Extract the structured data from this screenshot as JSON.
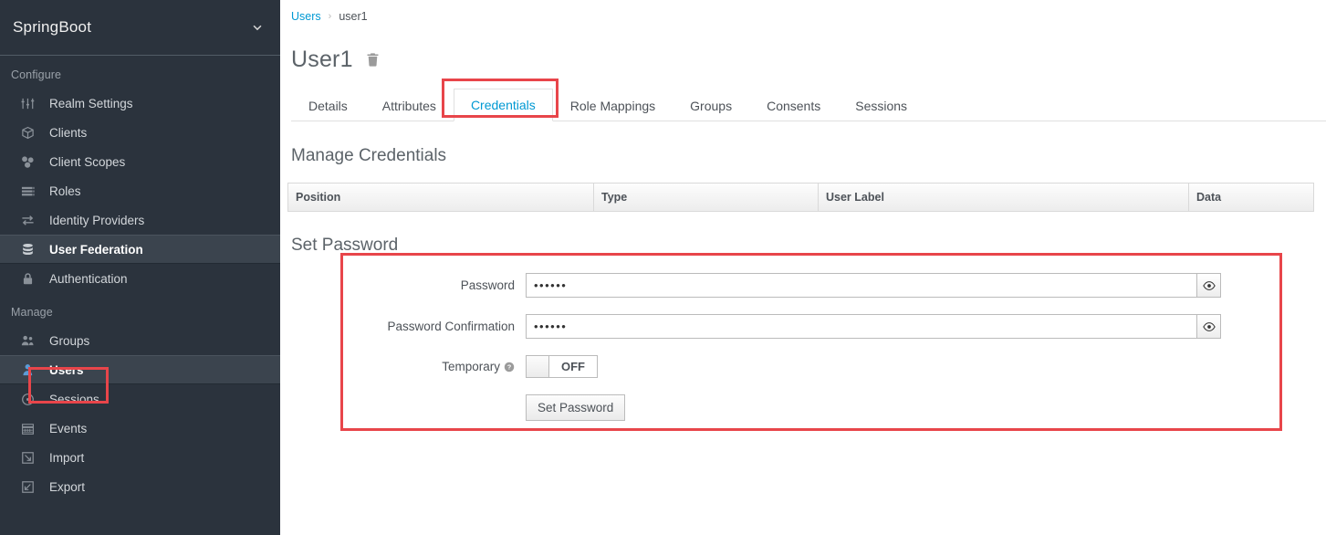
{
  "sidebar": {
    "realm": {
      "name": "SpringBoot",
      "chevron_icon": "chevron-down-icon"
    },
    "groups": [
      {
        "label": "Configure",
        "items": [
          {
            "label": "Realm Settings",
            "icon": "sliders-icon",
            "active": false
          },
          {
            "label": "Clients",
            "icon": "cube-icon",
            "active": false
          },
          {
            "label": "Client Scopes",
            "icon": "molecule-icon",
            "active": false
          },
          {
            "label": "Roles",
            "icon": "list-icon",
            "active": false
          },
          {
            "label": "Identity Providers",
            "icon": "exchange-arrows-icon",
            "active": false
          },
          {
            "label": "User Federation",
            "icon": "database-icon",
            "active": true
          },
          {
            "label": "Authentication",
            "icon": "lock-icon",
            "active": false
          }
        ]
      },
      {
        "label": "Manage",
        "items": [
          {
            "label": "Groups",
            "icon": "users-group-icon",
            "active": false
          },
          {
            "label": "Users",
            "icon": "user-icon",
            "active": true
          },
          {
            "label": "Sessions",
            "icon": "clock-icon",
            "active": false
          },
          {
            "label": "Events",
            "icon": "calendar-icon",
            "active": false
          },
          {
            "label": "Import",
            "icon": "import-arrow-icon",
            "active": false
          },
          {
            "label": "Export",
            "icon": "export-arrow-icon",
            "active": false
          }
        ]
      }
    ]
  },
  "breadcrumb": {
    "root": "Users",
    "separator": "›",
    "current": "user1"
  },
  "page": {
    "title": "User1",
    "delete_icon": "trash-icon"
  },
  "tabs": [
    {
      "label": "Details",
      "active": false
    },
    {
      "label": "Attributes",
      "active": false
    },
    {
      "label": "Credentials",
      "active": true
    },
    {
      "label": "Role Mappings",
      "active": false
    },
    {
      "label": "Groups",
      "active": false
    },
    {
      "label": "Consents",
      "active": false
    },
    {
      "label": "Sessions",
      "active": false
    }
  ],
  "manage_credentials": {
    "heading": "Manage Credentials",
    "columns": [
      "Position",
      "Type",
      "User Label",
      "Data"
    ],
    "rows": []
  },
  "set_password": {
    "heading": "Set Password",
    "password": {
      "label": "Password",
      "value": "••••••",
      "toggle_icon": "eye-icon"
    },
    "password_confirmation": {
      "label": "Password Confirmation",
      "value": "••••••",
      "toggle_icon": "eye-icon"
    },
    "temporary": {
      "label": "Temporary",
      "help_icon": "help-circle-icon",
      "state": "OFF"
    },
    "submit_label": "Set Password"
  },
  "colors": {
    "sidebar_bg": "#2b333d",
    "sidebar_active_bg": "#3b444e",
    "link_blue": "#0099d3",
    "annotation_red": "#e8454a",
    "text_gray": "#4d5258"
  },
  "annotations": [
    {
      "name": "credentials-tab-highlight",
      "target": "Credentials"
    },
    {
      "name": "users-nav-highlight",
      "target": "Users"
    },
    {
      "name": "set-password-form-highlight",
      "target": "Set Password"
    }
  ]
}
